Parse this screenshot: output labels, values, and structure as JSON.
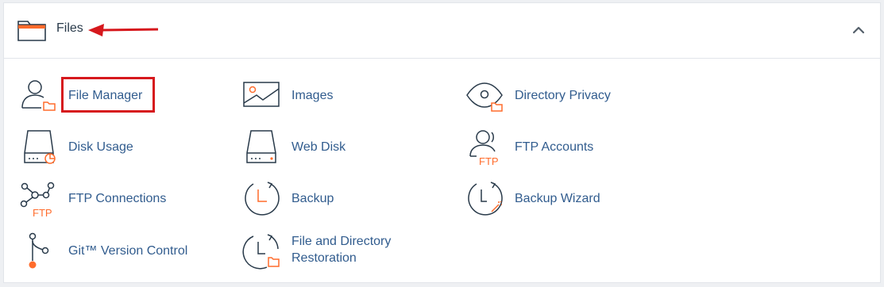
{
  "section": {
    "title": "Files",
    "collapse_icon": "chevron-up-icon"
  },
  "items": {
    "file_manager": "File Manager",
    "images": "Images",
    "directory_privacy": "Directory Privacy",
    "disk_usage": "Disk Usage",
    "web_disk": "Web Disk",
    "ftp_accounts": "FTP Accounts",
    "ftp_connections": "FTP Connections",
    "backup": "Backup",
    "backup_wizard": "Backup Wizard",
    "git_version_control": "Git™ Version Control",
    "file_dir_restoration_line1": "File and Directory",
    "file_dir_restoration_line2": "Restoration"
  },
  "icon_text": {
    "ftp": "FTP"
  },
  "colors": {
    "link": "#315c8e",
    "accent": "#ff6c2c",
    "annotation": "#d6181d",
    "icon_stroke": "#293a4a"
  }
}
